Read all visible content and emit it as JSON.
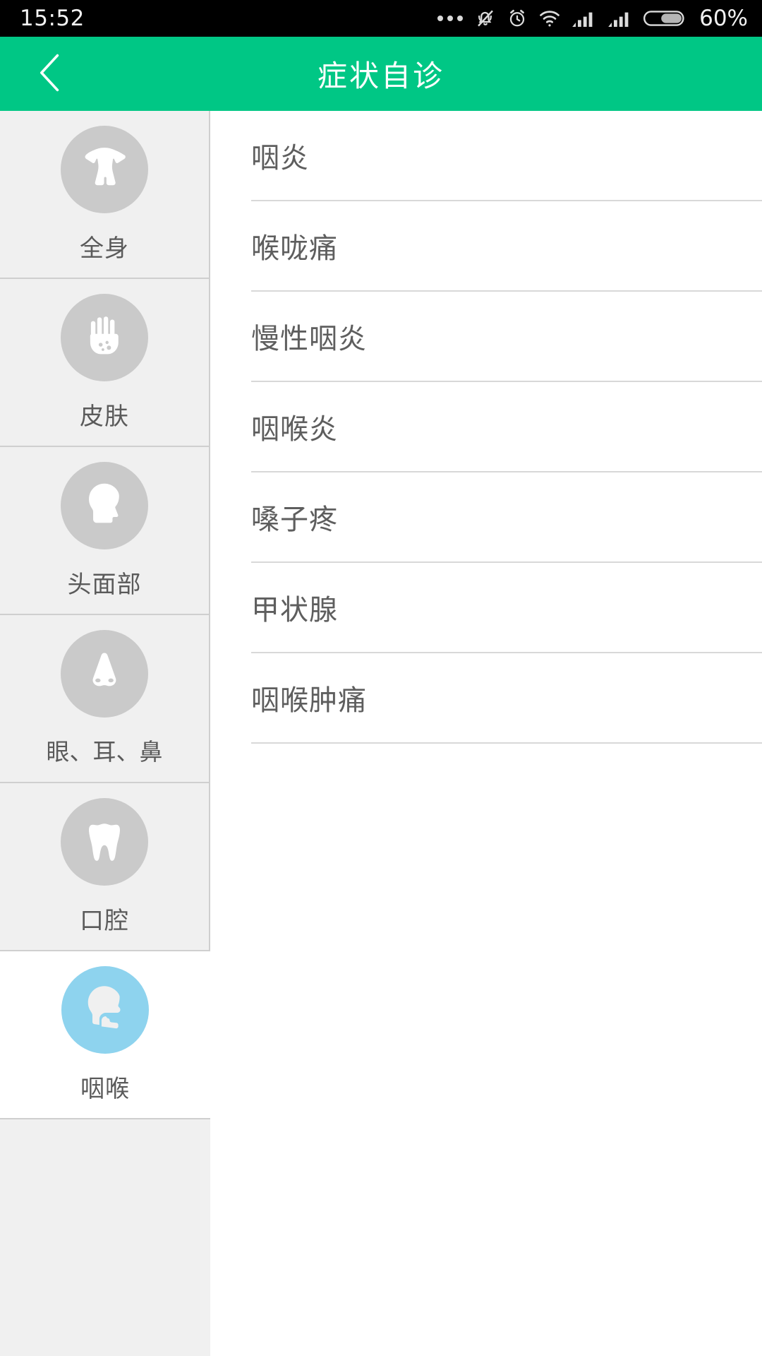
{
  "status_bar": {
    "time": "15:52",
    "battery_percent": "60%",
    "icons": [
      "more-dots-icon",
      "bell-muted-icon",
      "alarm-clock-icon",
      "wifi-icon",
      "signal-bars-icon",
      "signal-bars-icon",
      "battery-icon"
    ]
  },
  "header": {
    "title": "症状自诊",
    "back_icon": "chevron-left-icon",
    "accent_color": "#00c785"
  },
  "sidebar": {
    "active_index": 5,
    "active_color": "#8ed3ee",
    "inactive_color": "#cacaca",
    "items": [
      {
        "label": "全身",
        "icon": "torso-body-icon"
      },
      {
        "label": "皮肤",
        "icon": "hand-rash-icon"
      },
      {
        "label": "头面部",
        "icon": "head-profile-icon"
      },
      {
        "label": "眼、耳、鼻",
        "icon": "nose-icon"
      },
      {
        "label": "口腔",
        "icon": "tooth-icon"
      },
      {
        "label": "咽喉",
        "icon": "throat-head-icon"
      }
    ]
  },
  "main": {
    "rows": [
      {
        "label": "咽炎"
      },
      {
        "label": "喉咙痛"
      },
      {
        "label": "慢性咽炎"
      },
      {
        "label": "咽喉炎"
      },
      {
        "label": "嗓子疼"
      },
      {
        "label": "甲状腺"
      },
      {
        "label": "咽喉肿痛"
      }
    ]
  }
}
